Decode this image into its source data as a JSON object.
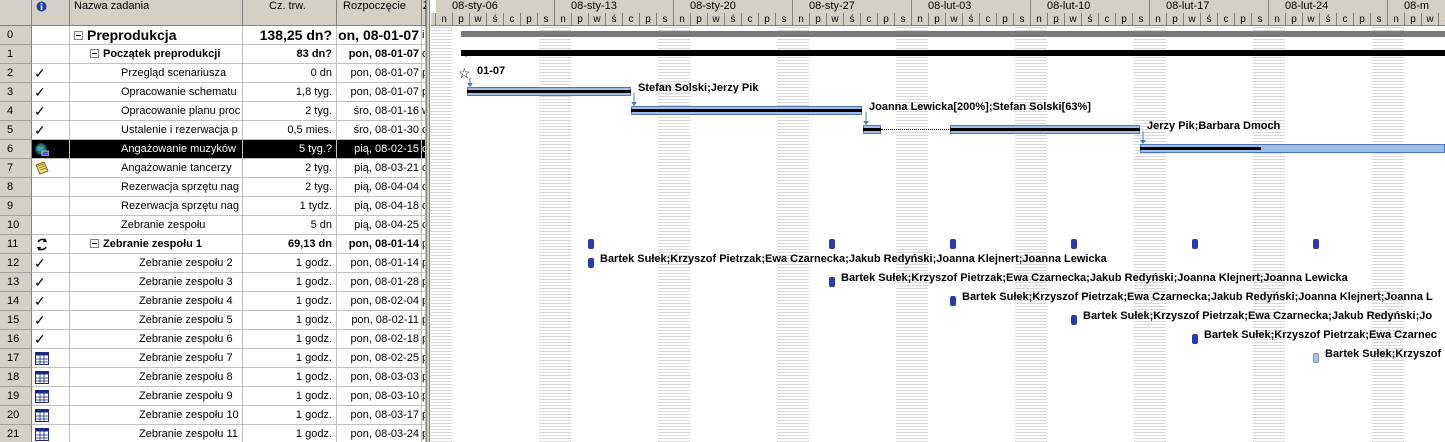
{
  "columns": {
    "id": "",
    "info_icon": "info-icon",
    "name": "Nazwa zadania",
    "duration": "Cz. trw.",
    "start": "Rozpoczęcie",
    "pred": "Z"
  },
  "tasks": [
    {
      "id": "0",
      "indicator": "",
      "name": "Preprodukcja",
      "duration": "138,25 dn?",
      "start": "on, 08-01-07",
      "pred": "ia",
      "level": 0,
      "summary": true
    },
    {
      "id": "1",
      "indicator": "",
      "name": "Początek preprodukcji",
      "duration": "83 dn?",
      "start": "pon, 08-01-07",
      "pred": "cz",
      "level": 1,
      "summary": true
    },
    {
      "id": "2",
      "indicator": "check",
      "name": "Przegląd scenariusza",
      "duration": "0 dn",
      "start": "pon, 08-01-07",
      "pred": "p",
      "level": 2
    },
    {
      "id": "3",
      "indicator": "check",
      "name": "Opracowanie schematu",
      "duration": "1,8 tyg.",
      "start": "pon, 08-01-07",
      "pred": "p",
      "level": 2
    },
    {
      "id": "4",
      "indicator": "check",
      "name": "Opracowanie planu proc",
      "duration": "2 tyg.",
      "start": "śro, 08-01-16",
      "pred": "w",
      "level": 2
    },
    {
      "id": "5",
      "indicator": "check",
      "name": "Ustalenie i rezerwacja p",
      "duration": "0,5 mies.",
      "start": "śro, 08-01-30",
      "pred": "cz",
      "level": 2
    },
    {
      "id": "6",
      "indicator": "globe",
      "name": "Angażowanie muzyków",
      "duration": "5 tyg.?",
      "start": "pią, 08-02-15",
      "pred": "cz",
      "level": 2,
      "selected": true
    },
    {
      "id": "7",
      "indicator": "note",
      "name": "Angażowanie tancerzy",
      "duration": "2 tyg.",
      "start": "pią, 08-03-21",
      "pred": "cz",
      "level": 2
    },
    {
      "id": "8",
      "indicator": "",
      "name": "Rezerwacja sprzętu nag",
      "duration": "2 tyg.",
      "start": "pią, 08-04-04",
      "pred": "cz",
      "level": 2
    },
    {
      "id": "9",
      "indicator": "",
      "name": "Rezerwacja sprzętu nag",
      "duration": "1 tydz.",
      "start": "pią, 08-04-18",
      "pred": "cz",
      "level": 2
    },
    {
      "id": "10",
      "indicator": "",
      "name": "Zebranie zespołu",
      "duration": "5 dn",
      "start": "pią, 08-04-25",
      "pred": "cz",
      "level": 2
    },
    {
      "id": "11",
      "indicator": "recur",
      "name": "Zebranie zespołu 1",
      "duration": "69,13 dn",
      "start": "pon, 08-01-14",
      "pred": "pe",
      "level": 1,
      "summary": true
    },
    {
      "id": "12",
      "indicator": "check",
      "name": "Zebranie zespołu 2",
      "duration": "1 godz.",
      "start": "pon, 08-01-14",
      "pred": "p",
      "level": 3
    },
    {
      "id": "13",
      "indicator": "check",
      "name": "Zebranie zespołu 3",
      "duration": "1 godz.",
      "start": "pon, 08-01-28",
      "pred": "p",
      "level": 3
    },
    {
      "id": "14",
      "indicator": "check",
      "name": "Zebranie zespołu 4",
      "duration": "1 godz.",
      "start": "pon, 08-02-04",
      "pred": "p",
      "level": 3
    },
    {
      "id": "15",
      "indicator": "check",
      "name": "Zebranie zespołu 5",
      "duration": "1 godz.",
      "start": "pon, 08-02-11",
      "pred": "p",
      "level": 3
    },
    {
      "id": "16",
      "indicator": "check",
      "name": "Zebranie zespołu 6",
      "duration": "1 godz.",
      "start": "pon, 08-02-18",
      "pred": "p",
      "level": 3
    },
    {
      "id": "17",
      "indicator": "table",
      "name": "Zebranie zespołu 7",
      "duration": "1 godz.",
      "start": "pon, 08-02-25",
      "pred": "p",
      "level": 3
    },
    {
      "id": "18",
      "indicator": "table",
      "name": "Zebranie zespołu 8",
      "duration": "1 godz.",
      "start": "pon, 08-03-03",
      "pred": "p",
      "level": 3
    },
    {
      "id": "19",
      "indicator": "table",
      "name": "Zebranie zespołu 9",
      "duration": "1 godz.",
      "start": "pon, 08-03-10",
      "pred": "p",
      "level": 3
    },
    {
      "id": "20",
      "indicator": "table",
      "name": "Zebranie zespołu 10",
      "duration": "1 godz.",
      "start": "pon, 08-03-17",
      "pred": "p",
      "level": 3
    },
    {
      "id": "21",
      "indicator": "table",
      "name": "Zebranie zespołu 11",
      "duration": "1 godz.",
      "start": "pon, 08-03-24",
      "pred": "p",
      "level": 3
    }
  ],
  "timescale": {
    "weeks": [
      "08-sty-06",
      "08-sty-13",
      "08-sty-20",
      "08-sty-27",
      "08-lut-03",
      "08-lut-10",
      "08-lut-17",
      "08-lut-24",
      "08-m"
    ],
    "days": [
      "n",
      "p",
      "w",
      "ś",
      "c",
      "p",
      "s"
    ]
  },
  "gantt_labels": {
    "milestone_date": "01-07",
    "r3": "Stefan Solski;Jerzy Pik",
    "r4": "Joanna Lewicka[200%];Stefan Solski[63%]",
    "r5": "Jerzy Pik;Barbara Dmoch",
    "r12": "Bartek Sułek;Krzyszof Pietrzak;Ewa Czarnecka;Jakub Redyński;Joanna Klejnert;Joanna Lewicka",
    "r13": "Bartek Sułek;Krzyszof Pietrzak;Ewa Czarnecka;Jakub Redyński;Joanna Klejnert;Joanna Lewicka",
    "r14": "Bartek Sułek;Krzyszof Pietrzak;Ewa Czarnecka;Jakub Redyński;Joanna Klejnert;Joanna L",
    "r15": "Bartek Sułek;Krzyszof Pietrzak;Ewa Czarnecka;Jakub Redyński;Jo",
    "r16": "Bartek Sułek;Krzyszof Pietrzak;Ewa Czarnec",
    "r17": "Bartek Sułek;Krzyszof"
  },
  "colors": {
    "header_bg": "#d4d0c8",
    "task_bar": "#9fbfe6",
    "milestone": "#2a3ab0",
    "selected": "#000000"
  }
}
